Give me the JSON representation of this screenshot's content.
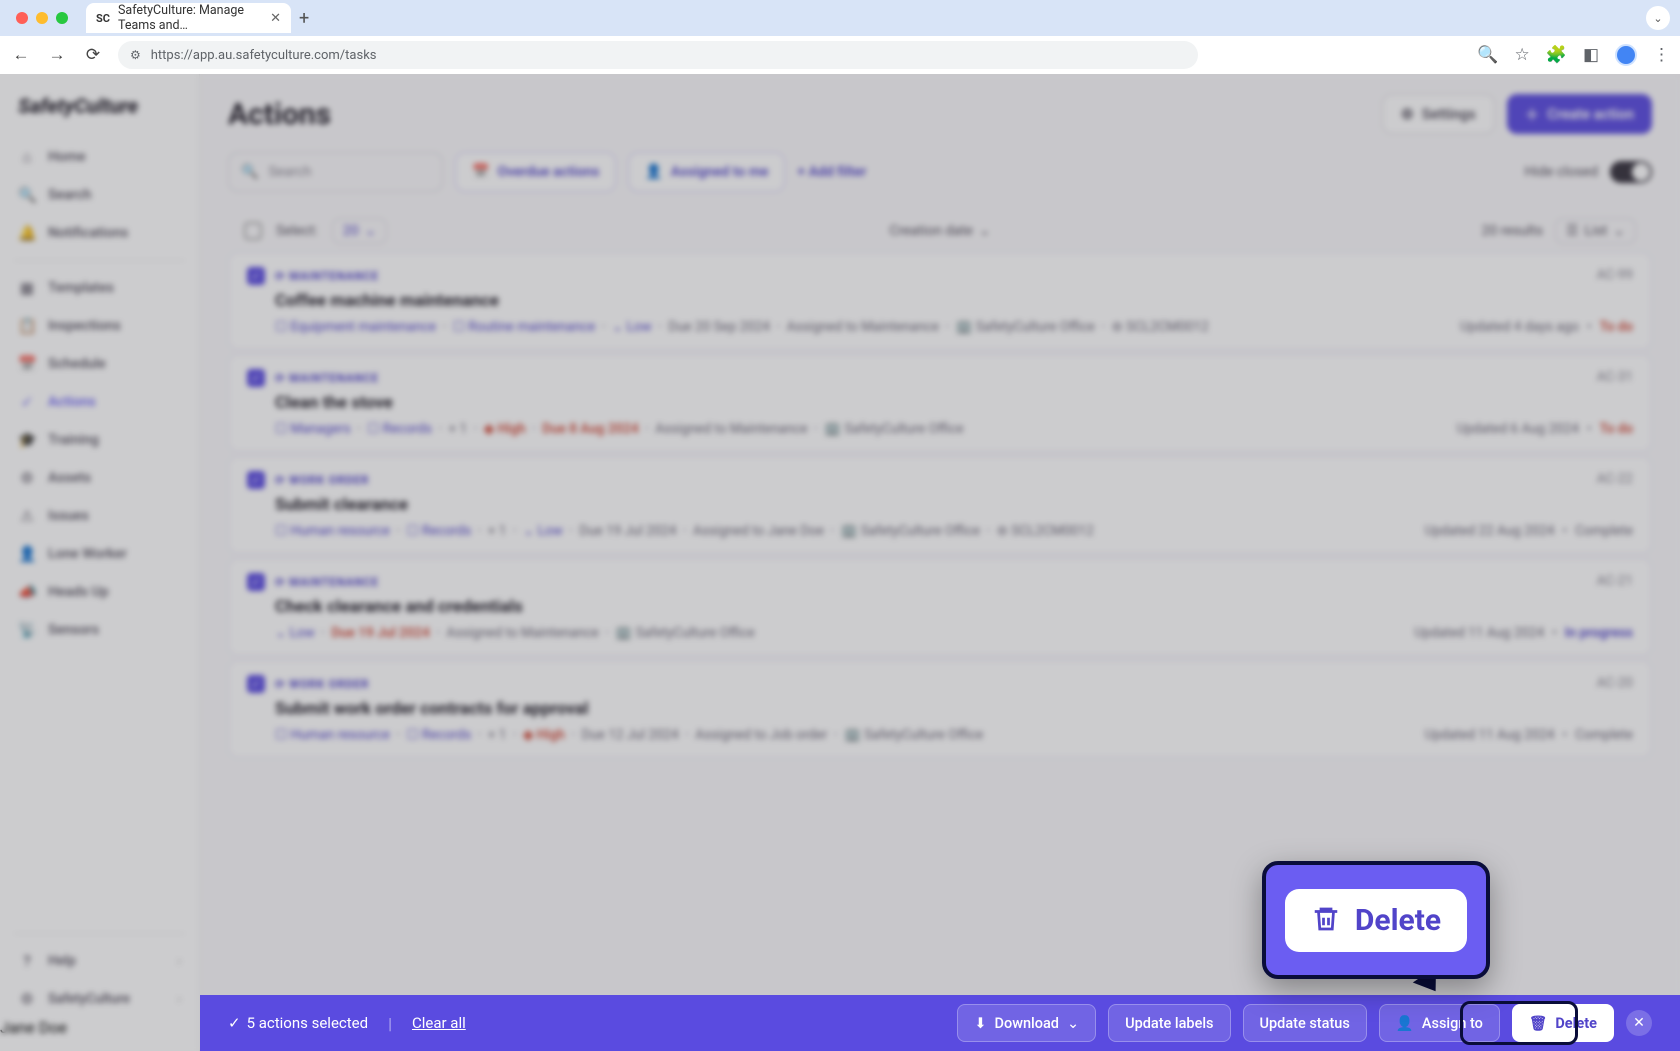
{
  "browser": {
    "tab_title": "SafetyCulture: Manage Teams and…",
    "url": "https://app.au.safetyculture.com/tasks"
  },
  "brand": "SafetyCulture",
  "sidebar": {
    "items": [
      {
        "label": "Home"
      },
      {
        "label": "Search"
      },
      {
        "label": "Notifications"
      },
      {
        "label": "Templates"
      },
      {
        "label": "Inspections"
      },
      {
        "label": "Schedule"
      },
      {
        "label": "Actions"
      },
      {
        "label": "Training"
      },
      {
        "label": "Assets"
      },
      {
        "label": "Issues"
      },
      {
        "label": "Lone Worker"
      },
      {
        "label": "Heads Up"
      },
      {
        "label": "Sensors"
      }
    ],
    "help_label": "Help",
    "org_name": "SafetyCulture",
    "user_name": "Jane Doe"
  },
  "header": {
    "title": "Actions",
    "settings_label": "Settings",
    "create_label": "Create action"
  },
  "filters": {
    "search_placeholder": "Search",
    "overdue_label": "Overdue actions",
    "assigned_label": "Assigned to me",
    "addfilter_label": "+ Add filter",
    "hide_closed_label": "Hide closed"
  },
  "listctrl": {
    "select_label": "Select:",
    "select_count": "20",
    "sort_label": "Creation date",
    "results_label": "20 results",
    "view_label": "List"
  },
  "actions": [
    {
      "category": "MAINTENANCE",
      "code": "AC-99",
      "title": "Coffee machine maintenance",
      "tags": [
        "Equipment maintenance",
        "Routine maintenance"
      ],
      "priority": "Low",
      "priority_class": "low",
      "due": "Due 20 Sep 2024",
      "due_over": false,
      "assigned": "Assigned to Maintenance",
      "site": "SafetyCulture Office",
      "asset": "SCL2CM0012",
      "updated": "Updated 4 days ago",
      "status": "To do",
      "status_class": "todo"
    },
    {
      "category": "MAINTENANCE",
      "code": "AC-31",
      "title": "Clean the stove",
      "tags": [
        "Managers",
        "Records"
      ],
      "extra": "+ 1",
      "priority": "High",
      "priority_class": "high",
      "due": "Due 8 Aug 2024",
      "due_over": true,
      "assigned": "Assigned to Maintenance",
      "site": "SafetyCulture Office",
      "updated": "Updated 6 Aug 2024",
      "status": "To do",
      "status_class": "todo"
    },
    {
      "category": "WORK ORDER",
      "code": "AC-22",
      "title": "Submit clearance",
      "tags": [
        "Human resource",
        "Records"
      ],
      "extra": "+ 1",
      "priority": "Low",
      "priority_class": "low",
      "due": "Due 19 Jul 2024",
      "due_over": false,
      "assigned": "Assigned to Jane Doe",
      "site": "SafetyCulture Office",
      "asset": "SCL2CM0012",
      "updated": "Updated 22 Aug 2024",
      "status": "Complete",
      "status_class": "complete"
    },
    {
      "category": "MAINTENANCE",
      "code": "AC-21",
      "title": "Check clearance and credentials",
      "priority": "Low",
      "priority_class": "low",
      "due": "Due 19 Jul 2024",
      "due_over": true,
      "assigned": "Assigned to Maintenance",
      "site": "SafetyCulture Office",
      "updated": "Updated 11 Aug 2024",
      "status": "In progress",
      "status_class": "prog"
    },
    {
      "category": "WORK ORDER",
      "code": "AC-20",
      "title": "Submit work order contracts for approval",
      "tags": [
        "Human resource",
        "Records"
      ],
      "extra": "+ 1",
      "priority": "High",
      "priority_class": "high",
      "due": "Due 12 Jul 2024",
      "due_over": false,
      "assigned": "Assigned to Job order",
      "site": "SafetyCulture Office",
      "updated": "Updated 11 Aug 2024",
      "status": "Complete",
      "status_class": "complete"
    }
  ],
  "actionbar": {
    "selected_label": "5 actions selected",
    "clear_label": "Clear all",
    "download_label": "Download",
    "update_labels": "Update labels",
    "update_status": "Update status",
    "assign_to": "Assign to",
    "delete_label": "Delete"
  },
  "magnified": {
    "delete_label": "Delete"
  }
}
